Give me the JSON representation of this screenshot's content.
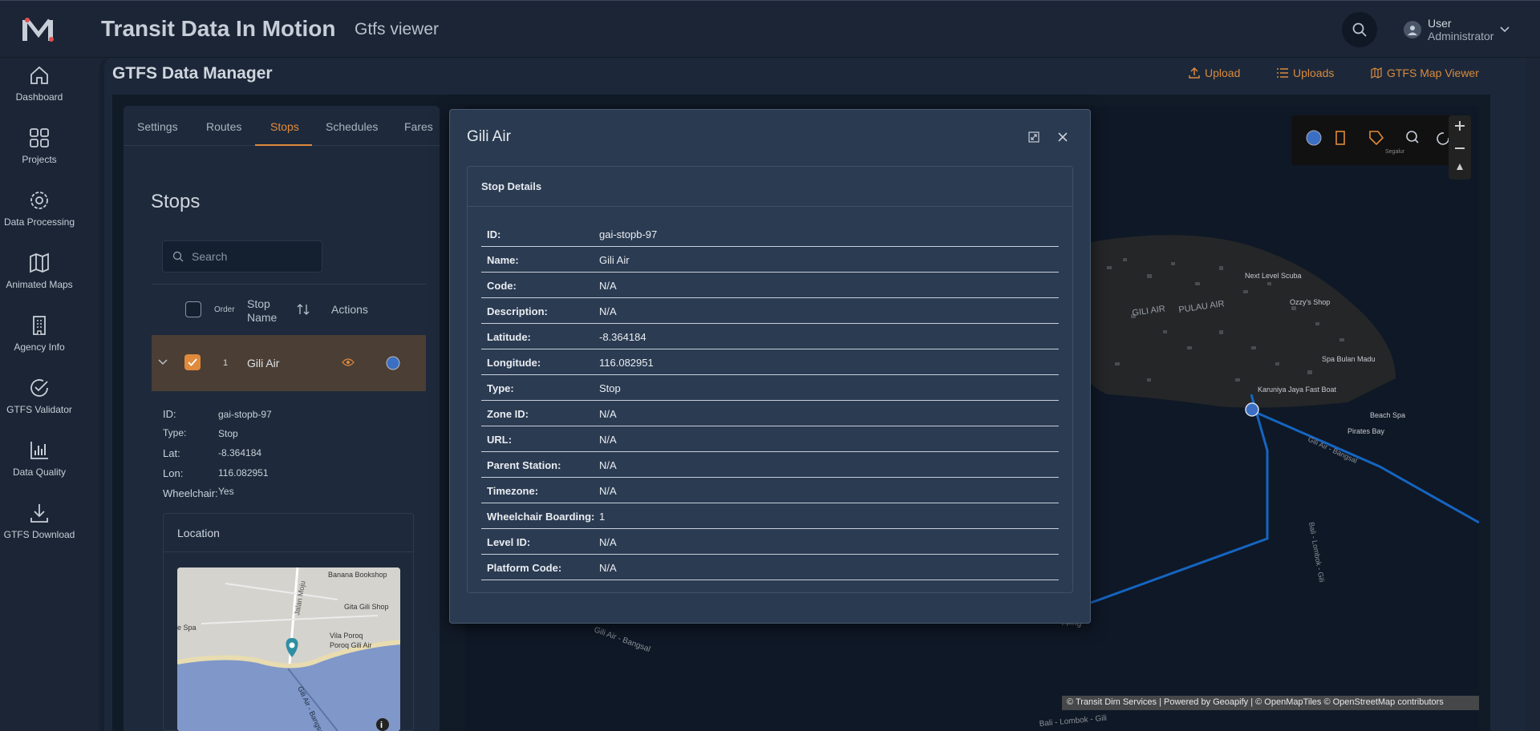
{
  "header": {
    "title": "Transit Data In Motion",
    "subtitle": "Gtfs viewer",
    "user_name": "User",
    "user_role": "Administrator"
  },
  "sidebar": {
    "items": [
      {
        "label": "Dashboard",
        "icon": "home-icon"
      },
      {
        "label": "Projects",
        "icon": "grid-icon"
      },
      {
        "label": "Data Processing",
        "icon": "gear-icon"
      },
      {
        "label": "Animated Maps",
        "icon": "map-icon"
      },
      {
        "label": "Agency Info",
        "icon": "building-icon"
      },
      {
        "label": "GTFS Validator",
        "icon": "check-circle-icon"
      },
      {
        "label": "Data Quality",
        "icon": "bar-chart-icon"
      },
      {
        "label": "GTFS Download",
        "icon": "download-icon"
      }
    ]
  },
  "page": {
    "title": "GTFS Data Manager",
    "actions": {
      "upload": "Upload",
      "uploads": "Uploads",
      "map_viewer": "GTFS Map Viewer"
    }
  },
  "tabs": [
    "Settings",
    "Routes",
    "Stops",
    "Schedules",
    "Fares"
  ],
  "active_tab": "Stops",
  "stops_panel": {
    "title": "Stops",
    "search_placeholder": "Search",
    "columns": {
      "order": "Order",
      "stop_name_1": "Stop",
      "stop_name_2": "Name",
      "actions": "Actions"
    },
    "row": {
      "order": "1",
      "name": "Gili Air"
    },
    "details": {
      "id_label": "ID:",
      "id": "gai-stopb-97",
      "type_label": "Type:",
      "type": "Stop",
      "lat_label": "Lat:",
      "lat": "-8.364184",
      "lon_label": "Lon:",
      "lon": "116.082951",
      "wheelchair_label": "Wheelchair:",
      "wheelchair": "Yes"
    },
    "location_title": "Location",
    "mini_map_labels": [
      "Banana Bookshop",
      "Gita Gili Shop",
      "Vila Poroq",
      "Poroq Gili Air",
      "Jalan Moju",
      "e Spa",
      "Gili Air - Bangsal"
    ]
  },
  "map": {
    "labels": [
      "GILI AIR",
      "PULAU AIR",
      "Next Level Scuba",
      "Ozzy's Shop",
      "Spa Bulan Madu",
      "Karuniya Jaya Fast Boat",
      "Beach Spa",
      "Pirates Bay",
      "Gili Air - Bangsal",
      "Bali - Lombok - Gili",
      "Island Hopping",
      "Gili Air - Bangsal",
      "Bali - Lombok - Gili",
      "Segalur"
    ],
    "attribution": "© Transit Dim Services | Powered by Geoapify | © OpenMapTiles © OpenStreetMap contributors",
    "route_color": "#1565c0",
    "stop_color": "#3a6fc4"
  },
  "modal": {
    "title": "Gili Air",
    "card_title": "Stop Details",
    "rows": [
      {
        "k": "ID:",
        "v": "gai-stopb-97"
      },
      {
        "k": "Name:",
        "v": "Gili Air"
      },
      {
        "k": "Code:",
        "v": "N/A"
      },
      {
        "k": "Description:",
        "v": "N/A"
      },
      {
        "k": "Latitude:",
        "v": "-8.364184"
      },
      {
        "k": "Longitude:",
        "v": "116.082951"
      },
      {
        "k": "Type:",
        "v": "Stop"
      },
      {
        "k": "Zone ID:",
        "v": "N/A"
      },
      {
        "k": "URL:",
        "v": "N/A"
      },
      {
        "k": "Parent Station:",
        "v": "N/A"
      },
      {
        "k": "Timezone:",
        "v": "N/A"
      },
      {
        "k": "Wheelchair Boarding:",
        "v": "1"
      },
      {
        "k": "Level ID:",
        "v": "N/A"
      },
      {
        "k": "Platform Code:",
        "v": "N/A"
      }
    ]
  },
  "colors": {
    "accent": "#e08a3c",
    "background": "#1b2535",
    "modal": "#2a3a50"
  }
}
